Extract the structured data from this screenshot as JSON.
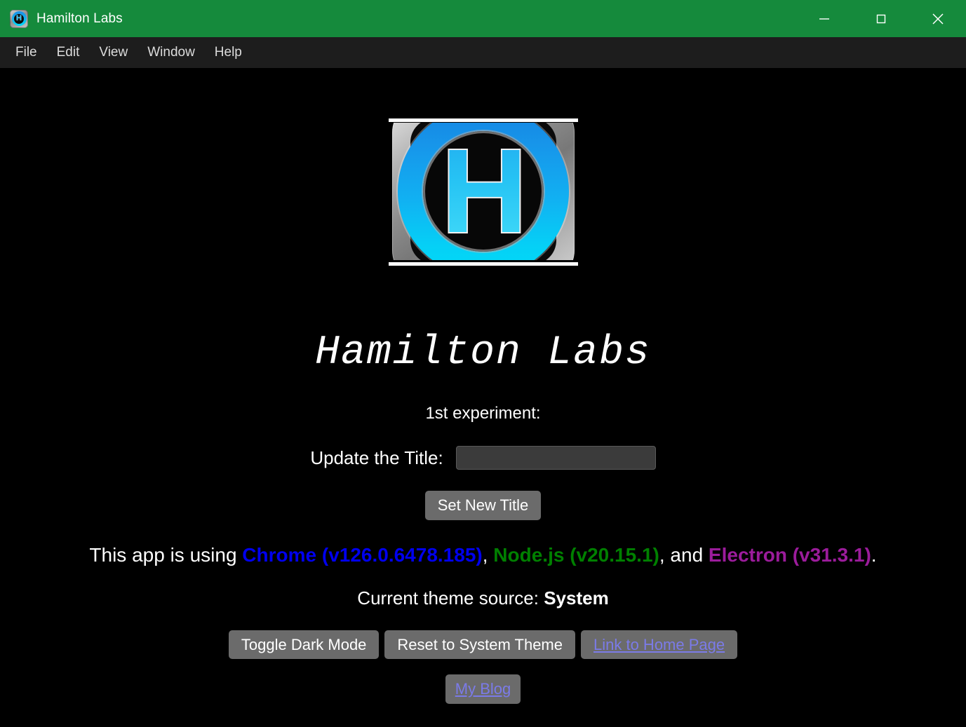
{
  "window": {
    "title": "Hamilton Labs",
    "app_icon": "hamilton-labs-app-icon",
    "accent_color": "#158A3C",
    "controls": [
      {
        "name": "minimize",
        "icon": "minimize-icon"
      },
      {
        "name": "maximize",
        "icon": "maximize-icon"
      },
      {
        "name": "close",
        "icon": "close-icon"
      }
    ]
  },
  "menubar": {
    "items": [
      {
        "label": "File"
      },
      {
        "label": "Edit"
      },
      {
        "label": "View"
      },
      {
        "label": "Window"
      },
      {
        "label": "Help"
      }
    ]
  },
  "main": {
    "logo_alt": "Hamilton Labs logo",
    "logo_letter": "H",
    "heading": "Hamilton Labs",
    "experiment_label": "1st experiment:",
    "form": {
      "label": "Update the Title:",
      "input_value": "",
      "input_placeholder": "",
      "submit_label": "Set New Title"
    },
    "versions": {
      "prefix": "This app is using ",
      "chrome": "Chrome (v126.0.6478.185)",
      "chrome_color": "#0000EE",
      "separator1": ", ",
      "node": "Node.js (v20.15.1)",
      "node_color": "#008000",
      "separator2": ", and ",
      "electron": "Electron (v31.3.1)",
      "electron_color": "#9B1C9B",
      "suffix": "."
    },
    "theme": {
      "label": "Current theme source: ",
      "value": "System"
    },
    "buttons": {
      "toggle_dark_mode": "Toggle Dark Mode",
      "reset_system_theme": "Reset to System Theme",
      "link_home_page": "Link to Home Page",
      "my_blog": "My Blog",
      "link_color": "#7B7BE8"
    }
  }
}
